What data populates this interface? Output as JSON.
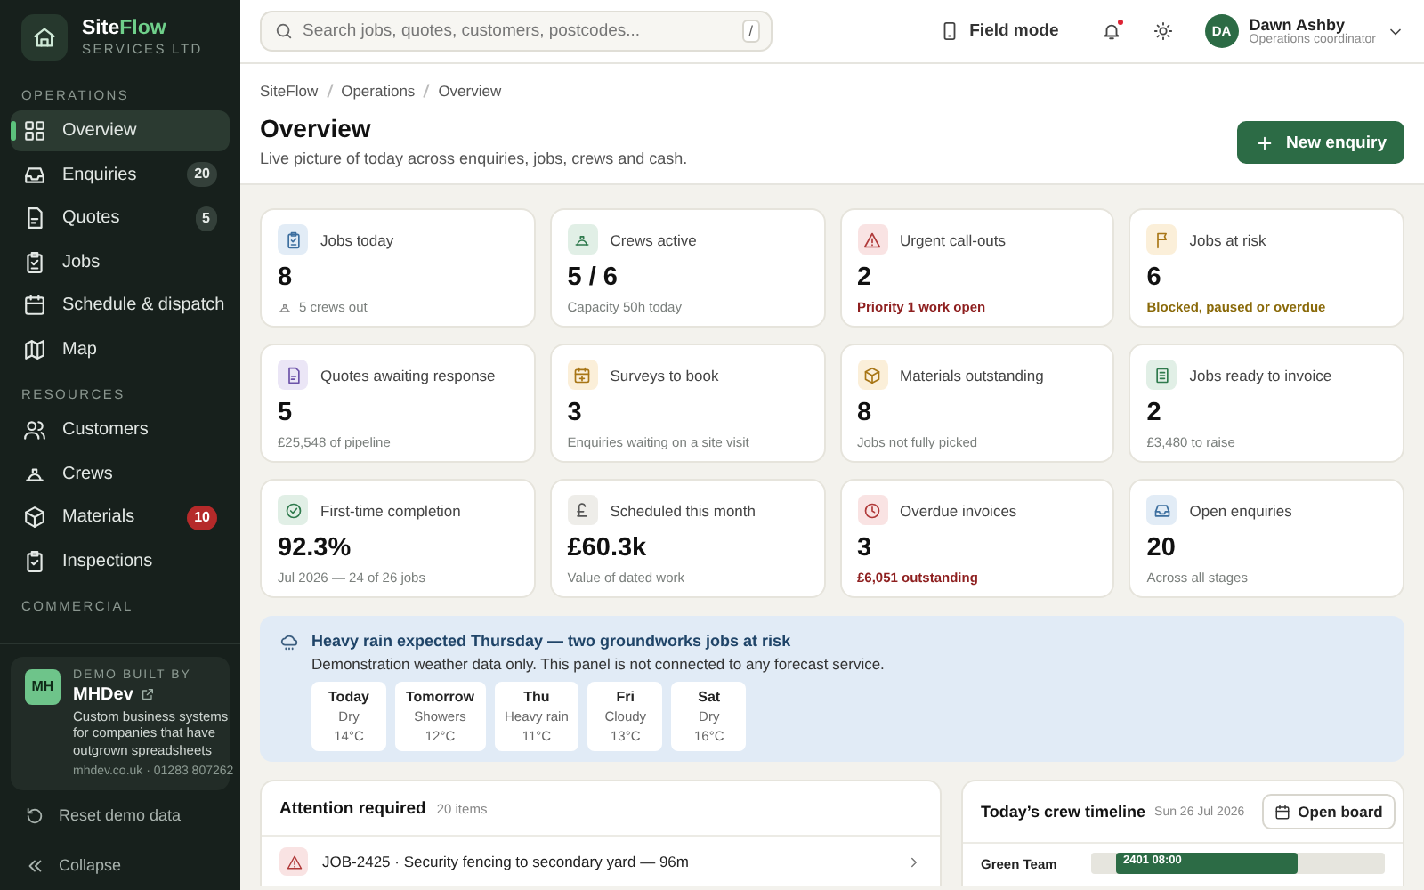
{
  "brand": {
    "name_first": "Site",
    "name_second": "Flow",
    "subtitle": "SERVICES LTD"
  },
  "sidebar": {
    "sections": [
      {
        "label": "OPERATIONS",
        "items": [
          {
            "label": "Overview",
            "selected": true
          },
          {
            "label": "Enquiries",
            "selected": false,
            "badge": "20",
            "badge_alert": false
          },
          {
            "label": "Quotes",
            "selected": false,
            "badge": "5",
            "badge_alert": false
          },
          {
            "label": "Jobs",
            "selected": false
          },
          {
            "label": "Schedule & dispatch",
            "selected": false
          },
          {
            "label": "Map",
            "selected": false
          }
        ]
      },
      {
        "label": "RESOURCES",
        "items": [
          {
            "label": "Customers",
            "selected": false
          },
          {
            "label": "Crews",
            "selected": false
          },
          {
            "label": "Materials",
            "selected": false,
            "badge": "10",
            "badge_alert": true
          },
          {
            "label": "Inspections",
            "selected": false
          }
        ]
      },
      {
        "label": "COMMERCIAL"
      }
    ],
    "demo": {
      "initials": "MH",
      "eyebrow": "DEMO BUILT BY",
      "name": "MHDev",
      "description": "Custom business systems for companies that have outgrown spreadsheets",
      "contact": "mhdev.co.uk · 01283 807262"
    },
    "footer": [
      "Reset demo data",
      "Collapse"
    ]
  },
  "topbar": {
    "search": {
      "placeholder": "Search jobs, quotes, customers, postcodes...",
      "shortcut": "/"
    },
    "field_mode": "Field mode",
    "notifications_unread": true,
    "user": {
      "initials": "DA",
      "name": "Dawn Ashby",
      "role": "Operations coordinator"
    }
  },
  "header": {
    "breadcrumbs": [
      "SiteFlow",
      "Operations",
      "Overview"
    ],
    "title": "Overview",
    "subtitle": "Live picture of today across enquiries, jobs, crews and cash.",
    "action": "New enquiry"
  },
  "stats": [
    {
      "label": "Jobs today",
      "value": "8",
      "note": "5 crews out",
      "kind": "muted",
      "color": "#e2ecf6"
    },
    {
      "label": "Crews active",
      "value": "5 / 6",
      "note": "Capacity 50h today",
      "kind": "muted",
      "color": "#e1efe6"
    },
    {
      "label": "Urgent call-outs",
      "value": "2",
      "note": "Priority 1 work open",
      "kind": "danger",
      "color": "#f9e3e3"
    },
    {
      "label": "Jobs at risk",
      "value": "6",
      "note": "Blocked, paused or overdue",
      "kind": "warning",
      "color": "#fbefd9"
    },
    {
      "label": "Quotes awaiting response",
      "value": "5",
      "note": "£25,548 of pipeline",
      "kind": "muted",
      "color": "#ebe6f6"
    },
    {
      "label": "Surveys to book",
      "value": "3",
      "note": "Enquiries waiting on a site visit",
      "kind": "muted",
      "color": "#fbefd9"
    },
    {
      "label": "Materials outstanding",
      "value": "8",
      "note": "Jobs not fully picked",
      "kind": "muted",
      "color": "#fbefd9"
    },
    {
      "label": "Jobs ready to invoice",
      "value": "2",
      "note": "£3,480 to raise",
      "kind": "muted",
      "color": "#e1efe6"
    },
    {
      "label": "First-time completion",
      "value": "92.3%",
      "note": "Jul 2026 — 24 of 26 jobs",
      "kind": "muted",
      "color": "#e1efe6"
    },
    {
      "label": "Scheduled this month",
      "value": "£60.3k",
      "note": "Value of dated work",
      "kind": "muted",
      "color": "#eeede9"
    },
    {
      "label": "Overdue invoices",
      "value": "3",
      "note": "£6,051 outstanding",
      "kind": "danger",
      "color": "#f9e3e3"
    },
    {
      "label": "Open enquiries",
      "value": "20",
      "note": "Across all stages",
      "kind": "muted",
      "color": "#e2ecf6"
    }
  ],
  "weather": {
    "title": "Heavy rain expected Thursday — two groundworks jobs at risk",
    "note": "Demonstration weather data only. This panel is not connected to any forecast service.",
    "days": [
      {
        "day": "Today",
        "condition": "Dry",
        "temp": "14°C"
      },
      {
        "day": "Tomorrow",
        "condition": "Showers",
        "temp": "12°C"
      },
      {
        "day": "Thu",
        "condition": "Heavy rain",
        "temp": "11°C"
      },
      {
        "day": "Fri",
        "condition": "Cloudy",
        "temp": "13°C"
      },
      {
        "day": "Sat",
        "condition": "Dry",
        "temp": "16°C"
      }
    ]
  },
  "attention": {
    "title": "Attention required",
    "count": "20 items",
    "items": [
      {
        "title": "JOB-2425 · Security fencing to secondary yard — 96m"
      }
    ]
  },
  "timeline": {
    "title": "Today’s crew timeline",
    "date": "Sun 26 Jul 2026",
    "action": "Open board",
    "rows": [
      {
        "crew": "Green Team",
        "block": "2401 08:00"
      }
    ]
  }
}
